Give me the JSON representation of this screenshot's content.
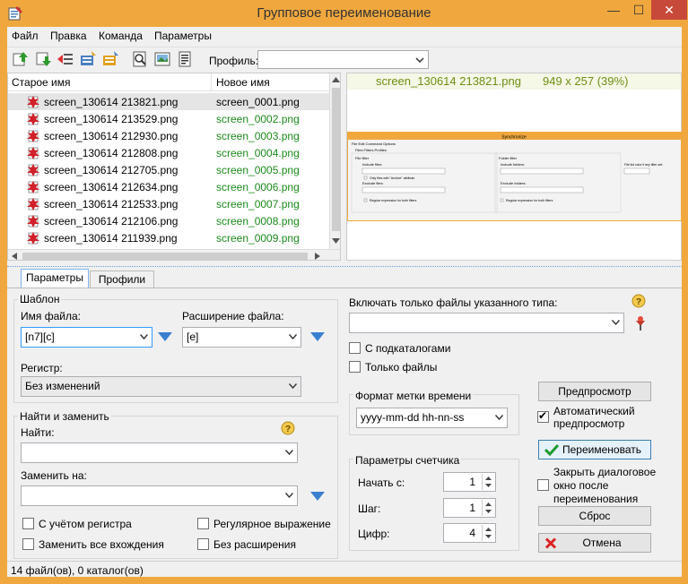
{
  "window": {
    "title": "Групповое переименование",
    "min": "—",
    "max": "☐",
    "close": "✕"
  },
  "menu": [
    "Файл",
    "Правка",
    "Команда",
    "Параметры"
  ],
  "toolbar": {
    "profile_label": "Профиль:",
    "profile_value": ""
  },
  "list": {
    "col_old": "Старое имя",
    "col_new": "Новое имя",
    "rows": [
      {
        "old": "screen_130614 213821.png",
        "new": "screen_0001.png"
      },
      {
        "old": "screen_130614 213529.png",
        "new": "screen_0002.png"
      },
      {
        "old": "screen_130614 212930.png",
        "new": "screen_0003.png"
      },
      {
        "old": "screen_130614 212808.png",
        "new": "screen_0004.png"
      },
      {
        "old": "screen_130614 212705.png",
        "new": "screen_0005.png"
      },
      {
        "old": "screen_130614 212634.png",
        "new": "screen_0006.png"
      },
      {
        "old": "screen_130614 212533.png",
        "new": "screen_0007.png"
      },
      {
        "old": "screen_130614 212106.png",
        "new": "screen_0008.png"
      },
      {
        "old": "screen_130614 211939.png",
        "new": "screen_0009.png"
      }
    ]
  },
  "preview": {
    "file": "screen_130614 213821.png",
    "size": "949 x 257 (39%)",
    "thumb": {
      "title": "Synchronize",
      "menu": "File   Edit   Command   Options",
      "tabs": "Files  Filters  Profiles",
      "file_filter": "File filter",
      "include_files": "Include files:",
      "only_archive": "Only files with \"Archive\" attribute",
      "exclude_files": "Exclude files:",
      "regex_both": "Regular expression for both filters",
      "folder_filter": "Folder filter",
      "include_folders": "Include folders:",
      "exclude_folders": "Exclude folders:",
      "regex_both2": "Regular expression for both filters",
      "color_note": "File list color if any filter set:"
    }
  },
  "tabs": [
    "Параметры",
    "Профили"
  ],
  "params": {
    "template_label": "Шаблон",
    "filename_label": "Имя файла:",
    "filename_value": "[n7][c]",
    "ext_label": "Расширение файла:",
    "ext_value": "[e]",
    "case_label": "Регистр:",
    "case_value": "Без изменений",
    "fr_label": "Найти и заменить",
    "find_label": "Найти:",
    "find_value": "",
    "replace_label": "Заменить на:",
    "replace_value": "",
    "match_case": "С учётом регистра",
    "replace_all": "Заменить все вхождения",
    "regex": "Регулярное выражение",
    "no_ext": "Без расширения",
    "include_type_label": "Включать только файлы указанного типа:",
    "include_type_value": "",
    "subdirs": "С подкаталогами",
    "files_only": "Только файлы",
    "timestamp_label": "Формат метки времени",
    "timestamp_value": "yyyy-mm-dd hh-nn-ss",
    "counter_label": "Параметры счетчика",
    "start_label": "Начать с:",
    "start_value": "1",
    "step_label": "Шаг:",
    "step_value": "1",
    "digits_label": "Цифр:",
    "digits_value": "4",
    "preview_btn": "Предпросмотр",
    "auto_preview": "Автоматический предпросмотр",
    "rename_btn": "Переименовать",
    "close_after": "Закрыть диалоговое окно после переименования",
    "reset_btn": "Сброс",
    "cancel_btn": "Отмена"
  },
  "status": "14 файл(ов), 0 каталог(ов)",
  "colors": {
    "frame": "#f0a83e",
    "accent": "#6f8f14",
    "new_name": "#1a8a1a"
  }
}
